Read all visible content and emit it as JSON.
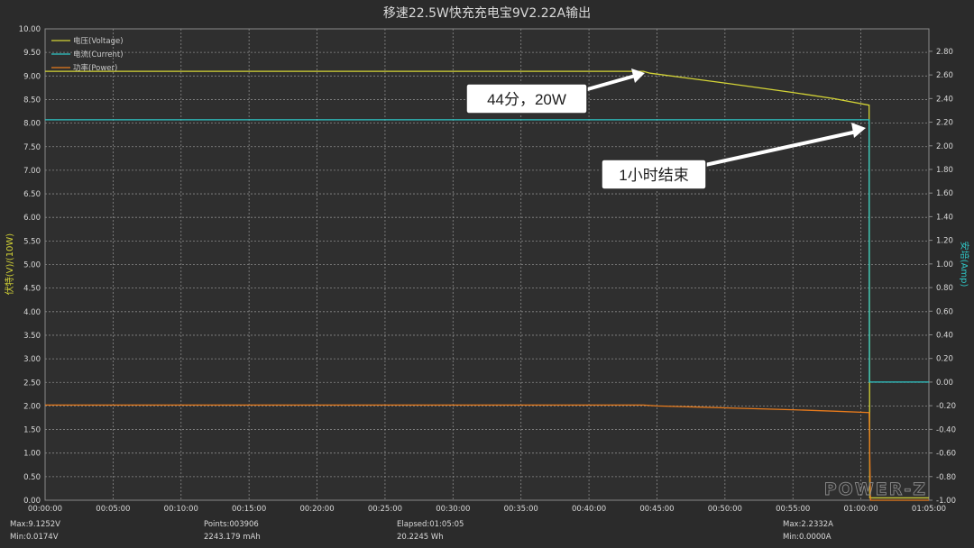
{
  "chart_data": {
    "type": "line",
    "title": "移速22.5W快充充电宝9V2.22A输出",
    "ylabel_left": "伏特(V)/(10W)",
    "ylabel_right": "安培(Amp)",
    "x_ticks": [
      "00:00:00",
      "00:05:00",
      "00:10:00",
      "00:15:00",
      "00:20:00",
      "00:25:00",
      "00:30:00",
      "00:35:00",
      "00:40:00",
      "00:45:00",
      "00:50:00",
      "00:55:00",
      "01:00:00",
      "01:05:00"
    ],
    "x_unit": "minutes",
    "xlim": [
      0,
      65
    ],
    "y_left_ticks": [
      "0.00",
      "0.50",
      "1.00",
      "1.50",
      "2.00",
      "2.50",
      "3.00",
      "3.50",
      "4.00",
      "4.50",
      "5.00",
      "5.50",
      "6.00",
      "6.50",
      "7.00",
      "7.50",
      "8.00",
      "8.50",
      "9.00",
      "9.50",
      "10.00"
    ],
    "ylim_left": [
      0,
      10
    ],
    "y_right_ticks": [
      "-1.00",
      "-0.80",
      "-0.60",
      "-0.40",
      "-0.20",
      "0.00",
      "0.20",
      "0.40",
      "0.60",
      "0.80",
      "1.00",
      "1.20",
      "1.40",
      "1.60",
      "1.80",
      "2.00",
      "2.20",
      "2.40",
      "2.60",
      "2.80"
    ],
    "ylim_right": [
      -1.0,
      2.99
    ],
    "grid": true,
    "legend_position": "top-left",
    "series": [
      {
        "name": "电压(Voltage)",
        "axis": "left",
        "color": "#d4d436",
        "x": [
          0,
          44,
          44.5,
          45,
          50,
          55,
          58,
          60.6,
          60.65,
          65
        ],
        "values": [
          9.1,
          9.1,
          9.06,
          9.04,
          8.85,
          8.65,
          8.52,
          8.38,
          0.05,
          0.05
        ]
      },
      {
        "name": "电流(Current)",
        "axis": "right",
        "color": "#2ec8c8",
        "x": [
          0,
          60.6,
          60.62,
          65
        ],
        "values": [
          2.22,
          2.22,
          0.0,
          0.0
        ]
      },
      {
        "name": "功率(Power)",
        "axis": "left",
        "color": "#e87b1c",
        "x": [
          0,
          44,
          45,
          50,
          55,
          58,
          60.6,
          60.7,
          65
        ],
        "values": [
          2.02,
          2.02,
          2.0,
          1.96,
          1.92,
          1.89,
          1.86,
          0.0,
          0.0
        ]
      }
    ],
    "annotations": [
      {
        "text": "44分，20W",
        "x": 44,
        "y_left": 9.1
      },
      {
        "text": "1小时结束",
        "x": 60.6,
        "y_left": 8.05
      }
    ]
  },
  "stats": {
    "max_v": "Max:9.1252V",
    "min_v": "Min:0.0174V",
    "points": "Points:003906",
    "mah": "2243.179 mAh",
    "elapsed": "Elapsed:01:05:05",
    "wh": "20.2245 Wh",
    "max_a": "Max:2.2332A",
    "min_a": "Min:0.0000A"
  },
  "watermark": "POWER-Z",
  "colors": {
    "background": "#2b2b2b",
    "plot_background": "#2f2f2f",
    "grid": "#8a8a8a",
    "left_axis_label": "#d4d436",
    "right_axis_label": "#2ec8c8"
  }
}
